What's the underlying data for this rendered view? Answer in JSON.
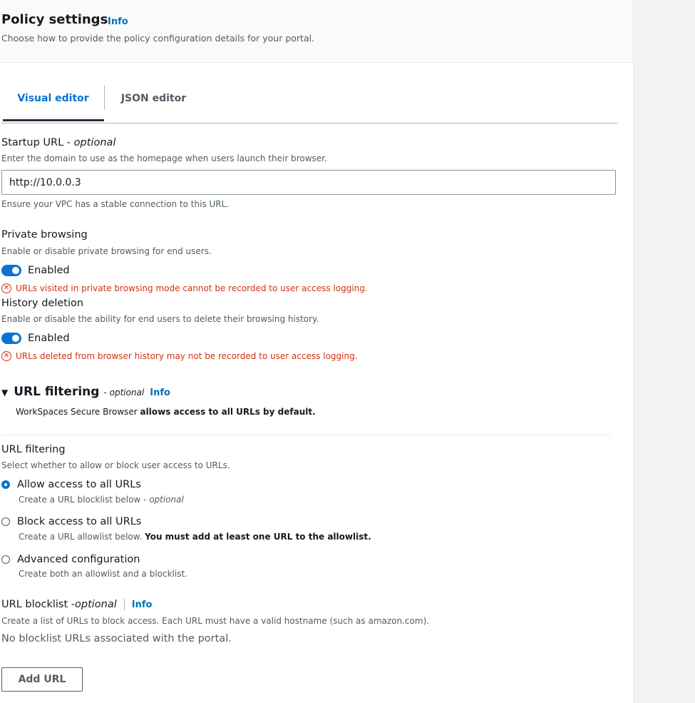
{
  "header": {
    "title": "Policy settings",
    "info": "Info",
    "description": "Choose how to provide the policy configuration details for your portal."
  },
  "tabs": [
    {
      "label": "Visual editor",
      "active": true
    },
    {
      "label": "JSON editor",
      "active": false
    }
  ],
  "startup_url": {
    "label": "Startup URL - ",
    "optional": "optional",
    "description": "Enter the domain to use as the homepage when users launch their browser.",
    "value": "http://10.0.0.3",
    "hint": "Ensure your VPC has a stable connection to this URL."
  },
  "private_browsing": {
    "label": "Private browsing",
    "description": "Enable or disable private browsing for end users.",
    "toggle_label": "Enabled",
    "enabled": true,
    "warning": "URLs visited in private browsing mode cannot be recorded to user access logging."
  },
  "history_deletion": {
    "label": "History deletion",
    "description": "Enable or disable the ability for end users to delete their browsing history.",
    "toggle_label": "Enabled",
    "enabled": true,
    "warning": "URLs deleted from browser history may not be recorded to user access logging."
  },
  "url_filtering_section": {
    "title": "URL filtering",
    "optional_prefix": "- ",
    "optional": "optional",
    "info": "Info",
    "description_prefix": "WorkSpaces Secure Browser ",
    "description_bold": "allows access to all URLs by default."
  },
  "url_filtering": {
    "label": "URL filtering",
    "description": "Select whether to allow or block user access to URLs.",
    "options": [
      {
        "label": "Allow access to all URLs",
        "desc": "Create a URL blocklist below - ",
        "desc_italic": "optional",
        "desc_bold": "",
        "selected": true
      },
      {
        "label": "Block access to all URLs",
        "desc": "Create a URL allowlist below. ",
        "desc_italic": "",
        "desc_bold": "You must add at least one URL to the allowlist.",
        "selected": false
      },
      {
        "label": "Advanced configuration",
        "desc": "Create both an allowlist and a blocklist.",
        "desc_italic": "",
        "desc_bold": "",
        "selected": false
      }
    ]
  },
  "url_blocklist": {
    "label": "URL blocklist - ",
    "optional": "optional",
    "info": "Info",
    "description": "Create a list of URLs to block access. Each URL must have a valid hostname (such as amazon.com).",
    "empty_text": "No blocklist URLs associated with the portal.",
    "add_button": "Add URL"
  },
  "icons": {
    "error": "error-circle-icon",
    "caret": "caret-down-filled-icon"
  },
  "colors": {
    "accent": "#0972d3",
    "error": "#d13212",
    "text": "#16191f",
    "secondary_text": "#545b64"
  }
}
